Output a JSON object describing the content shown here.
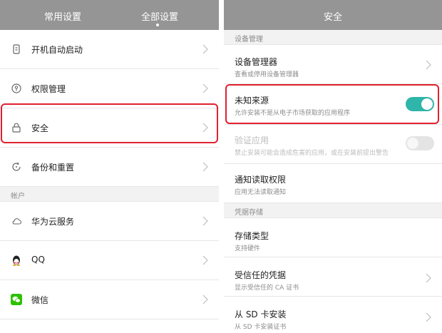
{
  "left_panel": {
    "tabs": [
      {
        "label": "常用设置"
      },
      {
        "label": "全部设置"
      }
    ],
    "items": [
      {
        "label": "开机自动启动",
        "icon": "power-startup-icon"
      },
      {
        "label": "权限管理",
        "icon": "permission-icon"
      },
      {
        "label": "安全",
        "icon": "lock-icon"
      },
      {
        "label": "备份和重置",
        "icon": "backup-icon"
      }
    ],
    "section_account": "帐户",
    "account_items": [
      {
        "label": "华为云服务",
        "icon": "cloud-icon"
      },
      {
        "label": "QQ",
        "icon": "qq-penguin-icon"
      },
      {
        "label": "微信",
        "icon": "wechat-icon"
      }
    ]
  },
  "right_panel": {
    "title": "安全",
    "section_device": "设备管理",
    "device_manager": {
      "title": "设备管理器",
      "subtitle": "查看或停用设备管理器"
    },
    "unknown_sources": {
      "title": "未知来源",
      "subtitle": "允许安装不是从电子市场获取的应用程序",
      "enabled": true
    },
    "verify_apps": {
      "title": "验证应用",
      "subtitle": "禁止安装可能会造成危害的应用，或在安装前提出警告",
      "enabled": false
    },
    "notification_access": {
      "title": "通知读取权限",
      "subtitle": "应用无法读取通知"
    },
    "section_credentials": "凭据存储",
    "storage_type": {
      "title": "存储类型",
      "subtitle": "支持硬件"
    },
    "trusted_credentials": {
      "title": "受信任的凭据",
      "subtitle": "显示受信任的 CA 证书"
    },
    "install_from_sd": {
      "title": "从 SD 卡安装",
      "subtitle": "从 SD 卡安装证书"
    }
  },
  "colors": {
    "header_bg": "#959595",
    "toggle_on": "#2fb5a9",
    "toggle_off": "#e4e4e4",
    "highlight": "#e0212f",
    "wechat_green": "#2dc100"
  }
}
